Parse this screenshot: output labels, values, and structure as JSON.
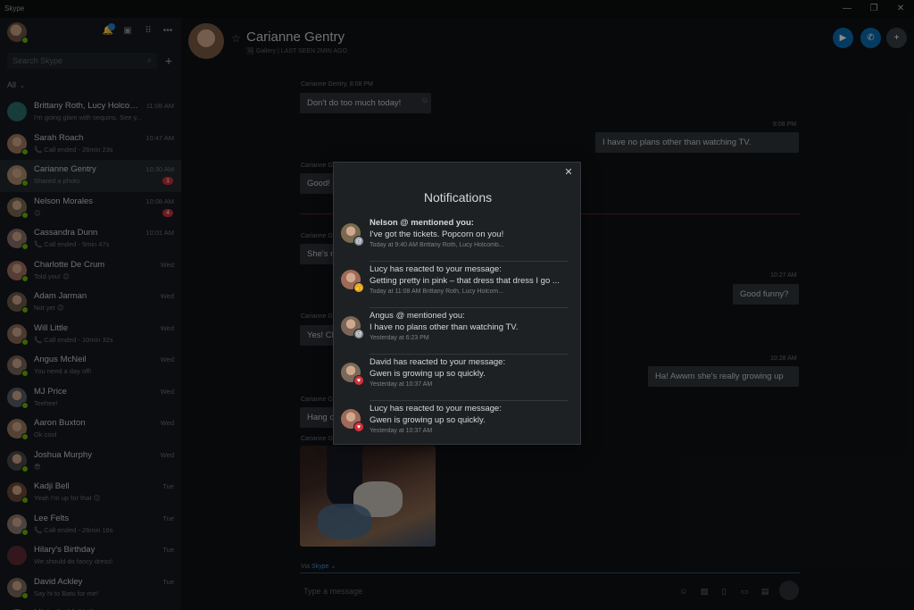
{
  "window": {
    "title": "Skype",
    "controls": [
      "—",
      "❐",
      "✕"
    ]
  },
  "sidebar": {
    "search_placeholder": "Search Skype",
    "filter_label": "All",
    "contacts": [
      {
        "name": "Brittany Roth, Lucy Holcom...",
        "time": "11:08 AM",
        "preview": "I'm going glam with sequins. See y...",
        "badge": "",
        "avatar_color": "#2b6e6a",
        "group": true
      },
      {
        "name": "Sarah Roach",
        "time": "10:47 AM",
        "preview": "📞 Call ended - 26min 23s",
        "badge": "",
        "avatar_color": "#a07860"
      },
      {
        "name": "Carianne Gentry",
        "time": "10:30 AM",
        "preview": "Shared a photo",
        "badge": "1",
        "avatar_color": "#b08a70"
      },
      {
        "name": "Nelson Morales",
        "time": "10:08 AM",
        "preview": "😊",
        "badge": "4",
        "avatar_color": "#7a6a50"
      },
      {
        "name": "Cassandra Dunn",
        "time": "10:01 AM",
        "preview": "📞 Call ended - 5min 47s",
        "badge": "",
        "avatar_color": "#8a7068"
      },
      {
        "name": "Charlotte De Crum",
        "time": "Wed",
        "preview": "Told you! 😊",
        "badge": "",
        "avatar_color": "#a07060"
      },
      {
        "name": "Adam Jarman",
        "time": "Wed",
        "preview": "Not yet 😊",
        "badge": "",
        "avatar_color": "#6e5a4a"
      },
      {
        "name": "Will Little",
        "time": "Wed",
        "preview": "📞 Call ended - 10min 32s",
        "badge": "",
        "avatar_color": "#8a6a58"
      },
      {
        "name": "Angus McNeil",
        "time": "Wed",
        "preview": "You need a day off!",
        "badge": "",
        "avatar_color": "#7a6658"
      },
      {
        "name": "MJ Price",
        "time": "Wed",
        "preview": "Teehee!",
        "badge": "",
        "avatar_color": "#5a5e68"
      },
      {
        "name": "Aaron Buxton",
        "time": "Wed",
        "preview": "Ok cool",
        "badge": "",
        "avatar_color": "#9a7a62"
      },
      {
        "name": "Joshua Murphy",
        "time": "Wed",
        "preview": "😎",
        "badge": "",
        "avatar_color": "#4e4a48"
      },
      {
        "name": "Kadji Bell",
        "time": "Tue",
        "preview": "Yeah I'm up for that 😊",
        "badge": "",
        "avatar_color": "#6a4a3a"
      },
      {
        "name": "Lee Felts",
        "time": "Tue",
        "preview": "📞 Call ended - 26min 16s",
        "badge": "",
        "avatar_color": "#8a7a72"
      },
      {
        "name": "Hilary's Birthday",
        "time": "Tue",
        "preview": "We should do fancy dress!",
        "badge": "",
        "avatar_color": "#5e2a34",
        "group": true
      },
      {
        "name": "David Ackley",
        "time": "Tue",
        "preview": "Say hi to Batu for me!",
        "badge": "",
        "avatar_color": "#7a6a5a"
      },
      {
        "name": "Michelle McNeil",
        "time": "",
        "preview": "",
        "badge": "",
        "avatar_color": "#8a7060"
      }
    ]
  },
  "chat": {
    "name": "Carianne Gentry",
    "subtitle": "🖼 Gallery  |  LAST SEEN 2MIN AGO",
    "messages": [
      {
        "meta": "Carianne Gentry, 8:08 PM",
        "text": "Don't do too much today!",
        "dir": "in"
      },
      {
        "meta": "8:08 PM",
        "text": "I have no plans other than watching TV.",
        "dir": "out"
      },
      {
        "meta": "Carianne G",
        "text": "Good! ",
        "dir": "in"
      },
      {
        "meta": "Carianne G",
        "text": "She's n",
        "dir": "in"
      },
      {
        "meta": "10:27 AM",
        "text": "Good funny?",
        "dir": "out"
      },
      {
        "meta": "Carianne G",
        "text": "Yes! Ch",
        "dir": "in"
      },
      {
        "meta": "10:28 AM",
        "text": "Ha! Awwm she's really growing up",
        "dir": "out"
      },
      {
        "meta": "Carianne G",
        "text": "Hang o",
        "dir": "in"
      },
      {
        "meta": "Carianne Gentry",
        "text": "",
        "dir": "in"
      }
    ],
    "via_label": "Via",
    "via_link": "Skype ⌄",
    "composer_placeholder": "Type a message"
  },
  "notifications": {
    "title": "Notifications",
    "items": [
      {
        "head": "Nelson @ mentioned you:",
        "bold": true,
        "body": "I've got the tickets. Popcorn on you!",
        "meta": "Today at 9:40 AM    Brittany Roth, Lucy Holcomb...",
        "mark": "@",
        "mark_type": "mention",
        "avatar_color": "#7a6a50"
      },
      {
        "head": "Lucy has reacted to your message:",
        "bold": false,
        "body": "Getting pretty in pink – that dress that dress I go ...",
        "meta": "Today at 11:08 AM    Brittany Roth, Lucy Holcom...",
        "mark": "👍",
        "mark_type": "thumb",
        "avatar_color": "#a06a58"
      },
      {
        "head": "Angus @ mentioned you:",
        "bold": false,
        "body": "I have no plans other than watching TV.",
        "meta": "Yesterday at 6:23 PM",
        "mark": "@",
        "mark_type": "mention",
        "avatar_color": "#7a6658"
      },
      {
        "head": "David has reacted to your message:",
        "bold": false,
        "body": "Gwen is growing up so quickly.",
        "meta": "Yesterday at 10:37 AM",
        "mark": "♥",
        "mark_type": "heart",
        "avatar_color": "#7a6a5a"
      },
      {
        "head": "Lucy has reacted to your message:",
        "bold": false,
        "body": "Gwen is growing up so quickly.",
        "meta": "Yesterday at 10:37 AM",
        "mark": "♥",
        "mark_type": "heart",
        "avatar_color": "#a06a58"
      }
    ]
  },
  "colors": {
    "accent": "#0078d4",
    "presence": "#6bb700",
    "badge": "#c7313b"
  }
}
